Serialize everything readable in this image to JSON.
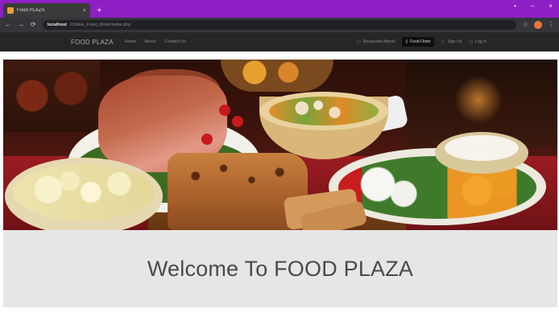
{
  "browser": {
    "tab_title": "Food PLAZA",
    "tab_close": "×",
    "new_tab": "+",
    "window_controls": [
      "•",
      "–",
      "×"
    ],
    "url_host": "localhost",
    "url_path": "/Online_Food_Order/index.php",
    "nav_icons": [
      "←",
      "→",
      "⟳"
    ],
    "toolbar_icons": [
      "☆",
      "⋮"
    ]
  },
  "site_nav": {
    "brand": "FOOD PLAZA",
    "links": [
      "Home",
      "About",
      "Contact Us"
    ],
    "right_items": [
      {
        "icon": "▢",
        "label": "Restaurant Admin",
        "active": false
      },
      {
        "icon": "▯",
        "label": "Food Order",
        "active": true
      },
      {
        "icon": "▢",
        "label": "Sign Up",
        "active": false
      },
      {
        "icon": "▢",
        "label": "Log In",
        "active": false
      }
    ]
  },
  "hero": {
    "image_name": "food-feast-banner"
  },
  "welcome": {
    "title": "Welcome To FOOD PLAZA"
  },
  "colors": {
    "tab_strip": "#8e1fc4",
    "toolbar": "#35363a",
    "site_nav": "#262626",
    "welcome_bg": "#e6e6e6",
    "welcome_text": "#4a4a4a"
  },
  "icons": [
    "favicon-icon",
    "back-icon",
    "forward-icon",
    "reload-icon",
    "star-icon",
    "menu-icon",
    "admin-icon",
    "cart-icon",
    "signup-icon",
    "login-icon"
  ]
}
